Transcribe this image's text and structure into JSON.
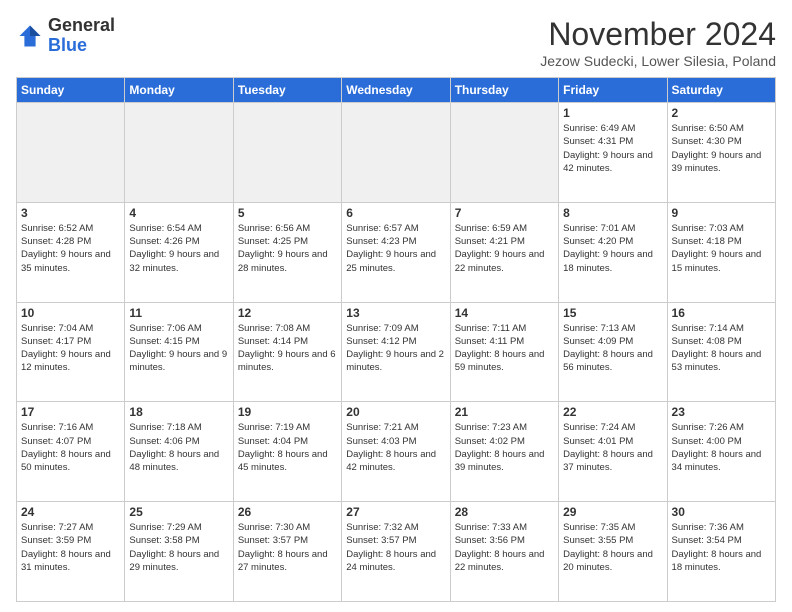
{
  "logo": {
    "general": "General",
    "blue": "Blue"
  },
  "header": {
    "month_title": "November 2024",
    "subtitle": "Jezow Sudecki, Lower Silesia, Poland"
  },
  "weekdays": [
    "Sunday",
    "Monday",
    "Tuesday",
    "Wednesday",
    "Thursday",
    "Friday",
    "Saturday"
  ],
  "weeks": [
    [
      {
        "day": "",
        "empty": true
      },
      {
        "day": "",
        "empty": true
      },
      {
        "day": "",
        "empty": true
      },
      {
        "day": "",
        "empty": true
      },
      {
        "day": "",
        "empty": true
      },
      {
        "day": "1",
        "sunrise": "Sunrise: 6:49 AM",
        "sunset": "Sunset: 4:31 PM",
        "daylight": "Daylight: 9 hours and 42 minutes."
      },
      {
        "day": "2",
        "sunrise": "Sunrise: 6:50 AM",
        "sunset": "Sunset: 4:30 PM",
        "daylight": "Daylight: 9 hours and 39 minutes."
      }
    ],
    [
      {
        "day": "3",
        "sunrise": "Sunrise: 6:52 AM",
        "sunset": "Sunset: 4:28 PM",
        "daylight": "Daylight: 9 hours and 35 minutes."
      },
      {
        "day": "4",
        "sunrise": "Sunrise: 6:54 AM",
        "sunset": "Sunset: 4:26 PM",
        "daylight": "Daylight: 9 hours and 32 minutes."
      },
      {
        "day": "5",
        "sunrise": "Sunrise: 6:56 AM",
        "sunset": "Sunset: 4:25 PM",
        "daylight": "Daylight: 9 hours and 28 minutes."
      },
      {
        "day": "6",
        "sunrise": "Sunrise: 6:57 AM",
        "sunset": "Sunset: 4:23 PM",
        "daylight": "Daylight: 9 hours and 25 minutes."
      },
      {
        "day": "7",
        "sunrise": "Sunrise: 6:59 AM",
        "sunset": "Sunset: 4:21 PM",
        "daylight": "Daylight: 9 hours and 22 minutes."
      },
      {
        "day": "8",
        "sunrise": "Sunrise: 7:01 AM",
        "sunset": "Sunset: 4:20 PM",
        "daylight": "Daylight: 9 hours and 18 minutes."
      },
      {
        "day": "9",
        "sunrise": "Sunrise: 7:03 AM",
        "sunset": "Sunset: 4:18 PM",
        "daylight": "Daylight: 9 hours and 15 minutes."
      }
    ],
    [
      {
        "day": "10",
        "sunrise": "Sunrise: 7:04 AM",
        "sunset": "Sunset: 4:17 PM",
        "daylight": "Daylight: 9 hours and 12 minutes."
      },
      {
        "day": "11",
        "sunrise": "Sunrise: 7:06 AM",
        "sunset": "Sunset: 4:15 PM",
        "daylight": "Daylight: 9 hours and 9 minutes."
      },
      {
        "day": "12",
        "sunrise": "Sunrise: 7:08 AM",
        "sunset": "Sunset: 4:14 PM",
        "daylight": "Daylight: 9 hours and 6 minutes."
      },
      {
        "day": "13",
        "sunrise": "Sunrise: 7:09 AM",
        "sunset": "Sunset: 4:12 PM",
        "daylight": "Daylight: 9 hours and 2 minutes."
      },
      {
        "day": "14",
        "sunrise": "Sunrise: 7:11 AM",
        "sunset": "Sunset: 4:11 PM",
        "daylight": "Daylight: 8 hours and 59 minutes."
      },
      {
        "day": "15",
        "sunrise": "Sunrise: 7:13 AM",
        "sunset": "Sunset: 4:09 PM",
        "daylight": "Daylight: 8 hours and 56 minutes."
      },
      {
        "day": "16",
        "sunrise": "Sunrise: 7:14 AM",
        "sunset": "Sunset: 4:08 PM",
        "daylight": "Daylight: 8 hours and 53 minutes."
      }
    ],
    [
      {
        "day": "17",
        "sunrise": "Sunrise: 7:16 AM",
        "sunset": "Sunset: 4:07 PM",
        "daylight": "Daylight: 8 hours and 50 minutes."
      },
      {
        "day": "18",
        "sunrise": "Sunrise: 7:18 AM",
        "sunset": "Sunset: 4:06 PM",
        "daylight": "Daylight: 8 hours and 48 minutes."
      },
      {
        "day": "19",
        "sunrise": "Sunrise: 7:19 AM",
        "sunset": "Sunset: 4:04 PM",
        "daylight": "Daylight: 8 hours and 45 minutes."
      },
      {
        "day": "20",
        "sunrise": "Sunrise: 7:21 AM",
        "sunset": "Sunset: 4:03 PM",
        "daylight": "Daylight: 8 hours and 42 minutes."
      },
      {
        "day": "21",
        "sunrise": "Sunrise: 7:23 AM",
        "sunset": "Sunset: 4:02 PM",
        "daylight": "Daylight: 8 hours and 39 minutes."
      },
      {
        "day": "22",
        "sunrise": "Sunrise: 7:24 AM",
        "sunset": "Sunset: 4:01 PM",
        "daylight": "Daylight: 8 hours and 37 minutes."
      },
      {
        "day": "23",
        "sunrise": "Sunrise: 7:26 AM",
        "sunset": "Sunset: 4:00 PM",
        "daylight": "Daylight: 8 hours and 34 minutes."
      }
    ],
    [
      {
        "day": "24",
        "sunrise": "Sunrise: 7:27 AM",
        "sunset": "Sunset: 3:59 PM",
        "daylight": "Daylight: 8 hours and 31 minutes."
      },
      {
        "day": "25",
        "sunrise": "Sunrise: 7:29 AM",
        "sunset": "Sunset: 3:58 PM",
        "daylight": "Daylight: 8 hours and 29 minutes."
      },
      {
        "day": "26",
        "sunrise": "Sunrise: 7:30 AM",
        "sunset": "Sunset: 3:57 PM",
        "daylight": "Daylight: 8 hours and 27 minutes."
      },
      {
        "day": "27",
        "sunrise": "Sunrise: 7:32 AM",
        "sunset": "Sunset: 3:57 PM",
        "daylight": "Daylight: 8 hours and 24 minutes."
      },
      {
        "day": "28",
        "sunrise": "Sunrise: 7:33 AM",
        "sunset": "Sunset: 3:56 PM",
        "daylight": "Daylight: 8 hours and 22 minutes."
      },
      {
        "day": "29",
        "sunrise": "Sunrise: 7:35 AM",
        "sunset": "Sunset: 3:55 PM",
        "daylight": "Daylight: 8 hours and 20 minutes."
      },
      {
        "day": "30",
        "sunrise": "Sunrise: 7:36 AM",
        "sunset": "Sunset: 3:54 PM",
        "daylight": "Daylight: 8 hours and 18 minutes."
      }
    ]
  ]
}
